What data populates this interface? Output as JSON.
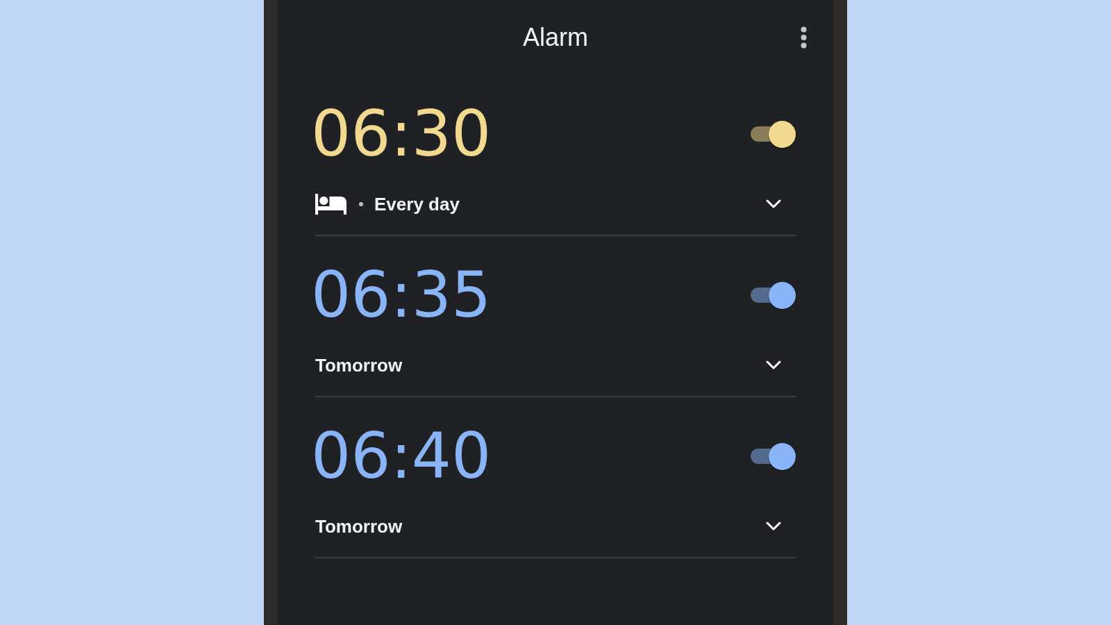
{
  "header": {
    "title": "Alarm"
  },
  "alarms": [
    {
      "kind": "bedtime",
      "time": "06:30",
      "color": "#f2d98f",
      "on": true,
      "schedule": "Every day",
      "expanded": false
    },
    {
      "kind": "alarm",
      "time": "06:35",
      "color": "#8ab4f8",
      "on": true,
      "schedule": "Tomorrow",
      "expanded": false
    },
    {
      "kind": "alarm",
      "time": "06:40",
      "color": "#8ab4f8",
      "on": true,
      "schedule": "Tomorrow",
      "expanded": false
    }
  ]
}
